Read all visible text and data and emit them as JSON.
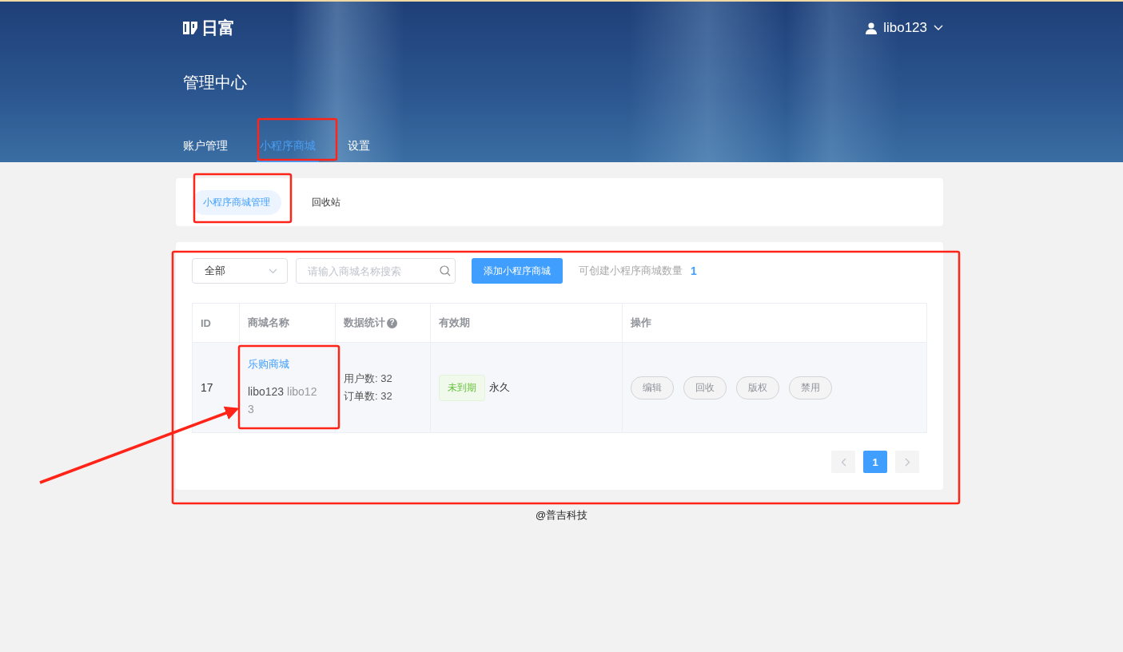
{
  "header": {
    "logo": "日富",
    "title": "管理中心",
    "user": "libo123",
    "nav": [
      {
        "label": "账户管理",
        "selected": false
      },
      {
        "label": "小程序商城",
        "selected": true
      },
      {
        "label": "设置",
        "selected": false
      }
    ]
  },
  "subtabs": [
    {
      "label": "小程序商城管理",
      "selected": true
    },
    {
      "label": "回收站",
      "selected": false
    }
  ],
  "toolbar": {
    "filter": "全部",
    "search_placeholder": "请输入商城名称搜索",
    "add_button": "添加小程序商城",
    "quota_label": "可创建小程序商城数量",
    "quota": "1"
  },
  "table": {
    "columns": [
      {
        "label": "ID"
      },
      {
        "label": "商城名称"
      },
      {
        "label": "数据统计",
        "help_icon": "?"
      },
      {
        "label": "有效期"
      },
      {
        "label": "操作"
      }
    ],
    "rows": [
      {
        "id": "17",
        "name": "乐购商城",
        "owner": "libo123",
        "account": "libo123",
        "users": "用户数: 32",
        "orders": "订单数: 32",
        "status": "未到期",
        "validity": "永久",
        "actions": [
          "编辑",
          "回收",
          "版权",
          "禁用"
        ]
      }
    ]
  },
  "pagination": {
    "pages": [
      {
        "label": "1",
        "selected": true
      }
    ]
  },
  "footer": "@普吉科技"
}
